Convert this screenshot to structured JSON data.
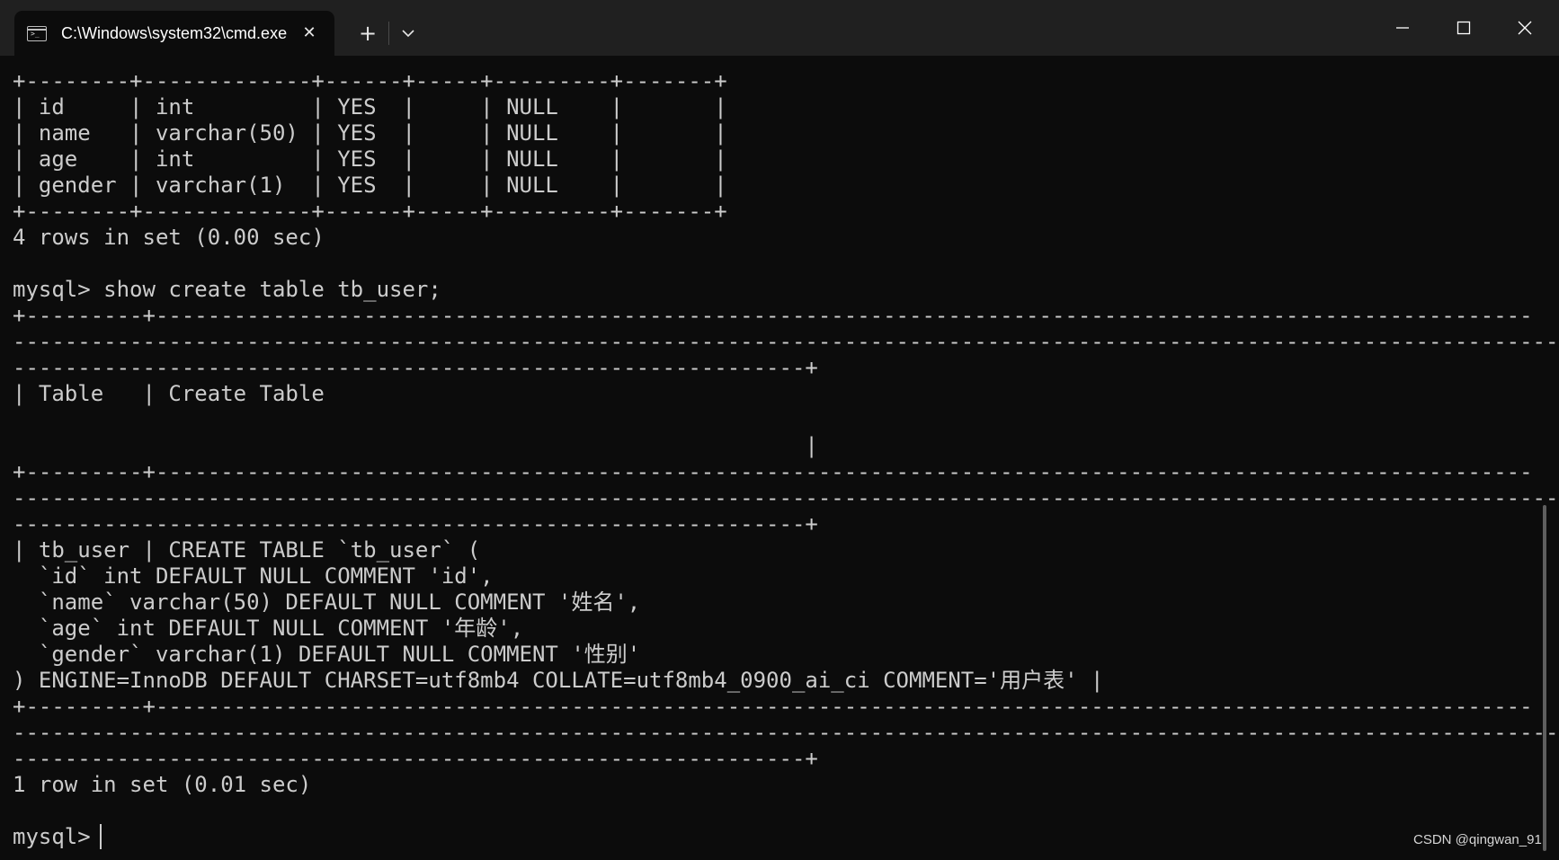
{
  "window": {
    "tab_icon_glyph": ">_",
    "tab_title": "C:\\Windows\\system32\\cmd.exe",
    "tab_close_glyph": "✕",
    "new_tab_glyph": "+",
    "dropdown_icon": "chevron-down-icon",
    "minimize_icon": "minimize-icon",
    "maximize_icon": "maximize-icon",
    "close_icon": "close-icon"
  },
  "terminal": {
    "lines": [
      "+--------+-------------+------+-----+---------+-------+",
      "| id     | int         | YES  |     | NULL    |       |",
      "| name   | varchar(50) | YES  |     | NULL    |       |",
      "| age    | int         | YES  |     | NULL    |       |",
      "| gender | varchar(1)  | YES  |     | NULL    |       |",
      "+--------+-------------+------+-----+---------+-------+",
      "4 rows in set (0.00 sec)",
      "",
      "mysql> show create table tb_user;",
      "+---------+----------------------------------------------------------------------------------------------------------",
      "-----------------------------------------------------------------------------------------------------------------------",
      "-------------------------------------------------------------+",
      "| Table   | Create Table",
      "",
      "                                                             |",
      "+---------+----------------------------------------------------------------------------------------------------------",
      "-----------------------------------------------------------------------------------------------------------------------",
      "-------------------------------------------------------------+",
      "| tb_user | CREATE TABLE `tb_user` (",
      "  `id` int DEFAULT NULL COMMENT 'id',",
      "  `name` varchar(50) DEFAULT NULL COMMENT '姓名',",
      "  `age` int DEFAULT NULL COMMENT '年龄',",
      "  `gender` varchar(1) DEFAULT NULL COMMENT '性别'",
      ") ENGINE=InnoDB DEFAULT CHARSET=utf8mb4 COLLATE=utf8mb4_0900_ai_ci COMMENT='用户表' |",
      "+---------+----------------------------------------------------------------------------------------------------------",
      "-----------------------------------------------------------------------------------------------------------------------",
      "-------------------------------------------------------------+",
      "1 row in set (0.01 sec)",
      "",
      "mysql> "
    ]
  },
  "watermark": "CSDN @qingwan_91",
  "colors": {
    "background": "#0c0c0c",
    "titlebar": "#202020",
    "text": "#cccccc"
  }
}
